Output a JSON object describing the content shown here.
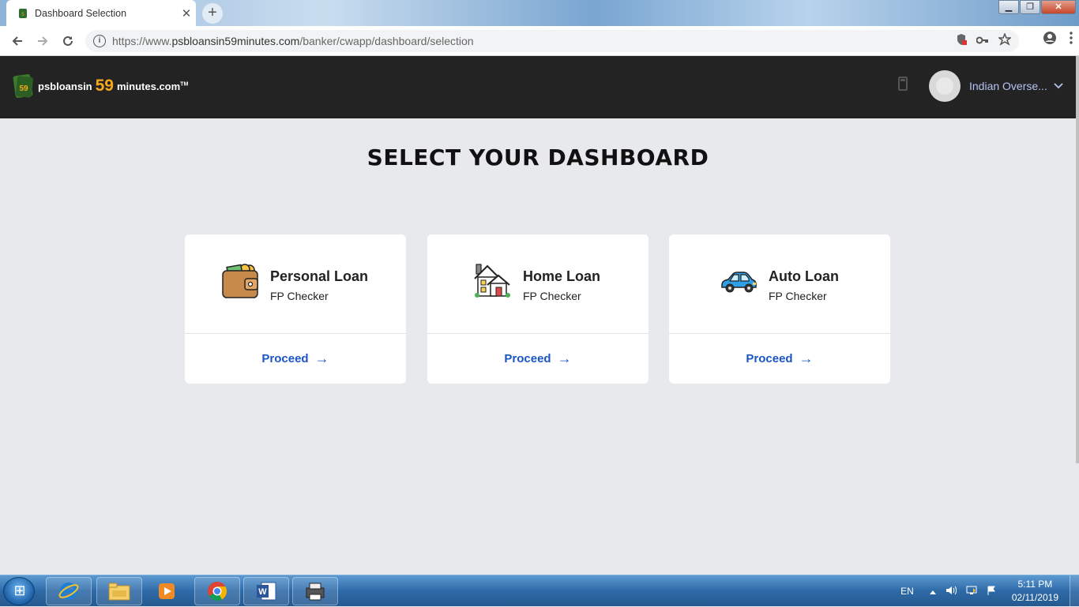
{
  "browser": {
    "tab_title": "Dashboard Selection",
    "tab_close": "✕",
    "new_tab": "+",
    "url_prefix": "https://www.",
    "url_domain": "psbloansin59minutes.com",
    "url_path": "/banker/cwapp/dashboard/selection",
    "window_controls": {
      "minimize": "▁",
      "maximize": "❐",
      "close": "✕"
    }
  },
  "header": {
    "brand_part1": "psbloansin",
    "brand_part2": "59",
    "brand_part3": "minutes.com",
    "brand_tm": "TM",
    "user_name": "Indian Overse...",
    "chevron": "⌄"
  },
  "main": {
    "heading": "SELECT YOUR DASHBOARD",
    "cards": [
      {
        "title": "Personal Loan",
        "subtitle": "FP Checker",
        "action": "Proceed",
        "arrow": "→",
        "icon": "wallet-icon"
      },
      {
        "title": "Home Loan",
        "subtitle": "FP Checker",
        "action": "Proceed",
        "arrow": "→",
        "icon": "house-icon"
      },
      {
        "title": "Auto Loan",
        "subtitle": "FP Checker",
        "action": "Proceed",
        "arrow": "→",
        "icon": "car-icon"
      }
    ]
  },
  "taskbar": {
    "language": "EN",
    "time": "5:11 PM",
    "date": "02/11/2019",
    "apps": [
      "internet-explorer-icon",
      "file-explorer-icon",
      "media-player-icon",
      "chrome-icon",
      "word-icon",
      "printer-icon"
    ]
  }
}
